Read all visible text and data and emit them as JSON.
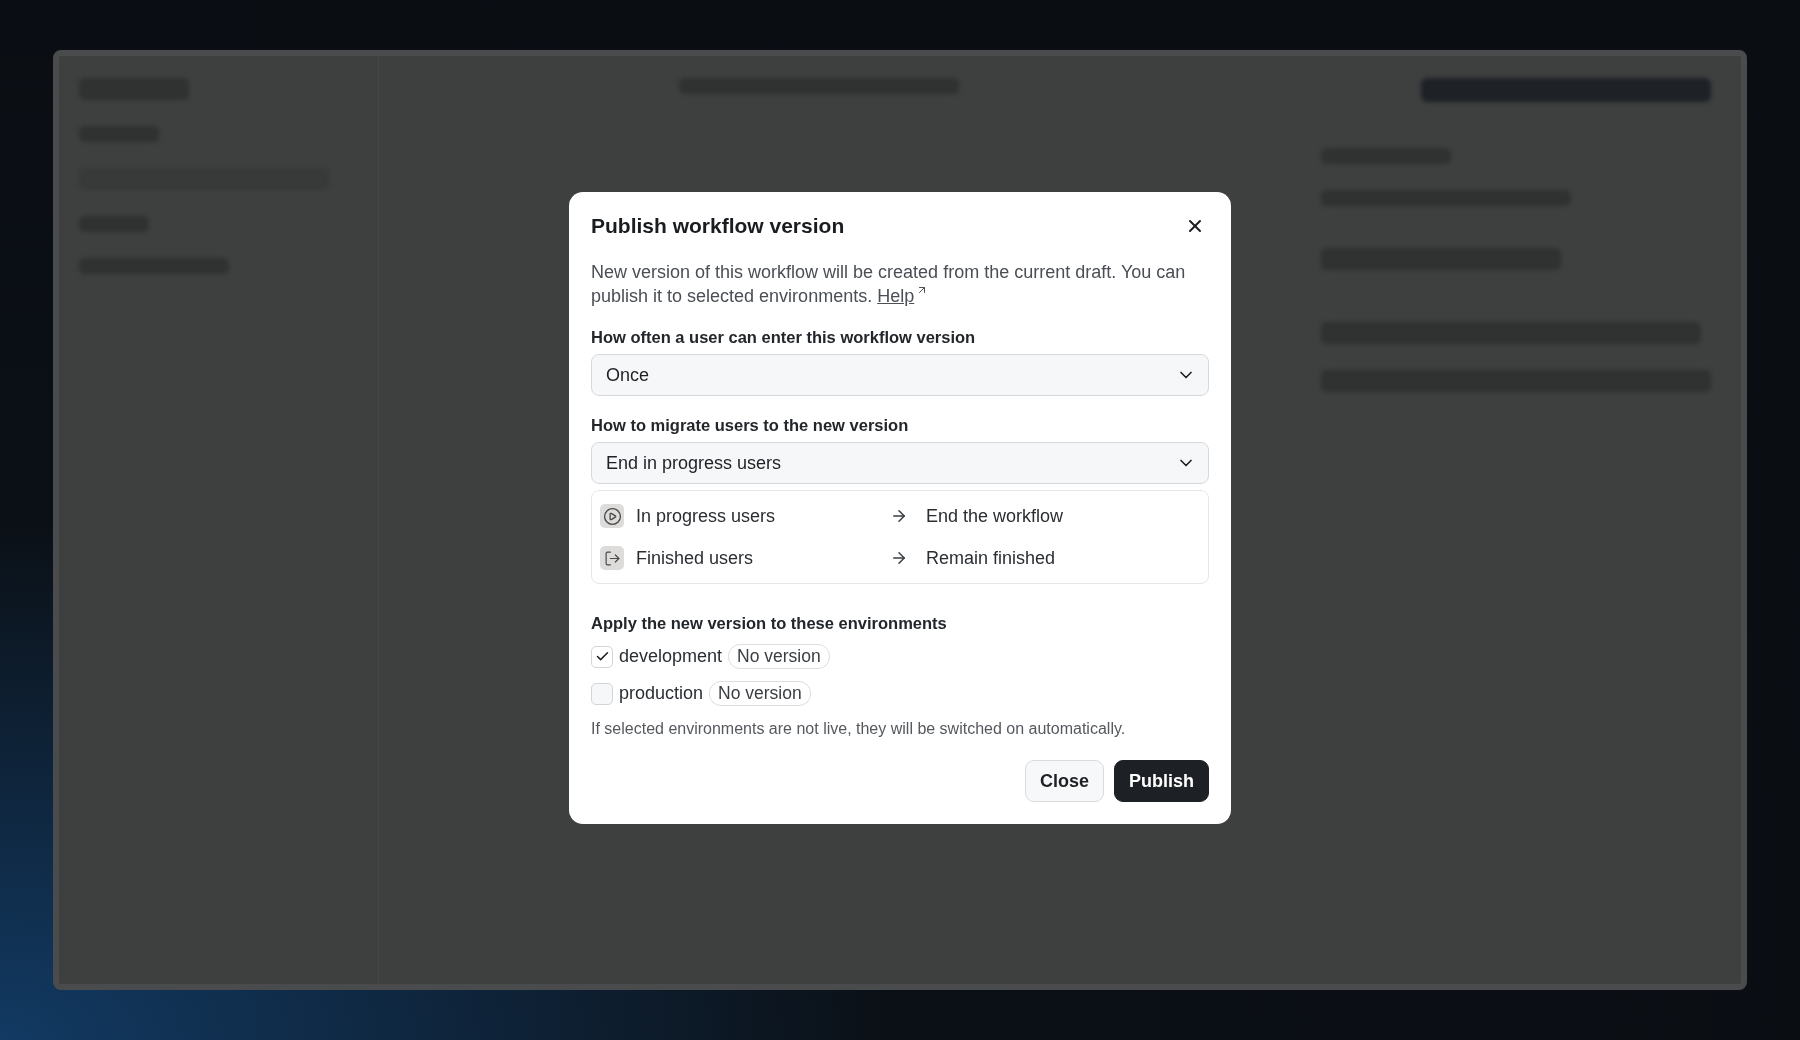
{
  "dialog": {
    "title": "Publish workflow version",
    "description": "New version of this workflow will be created from the current draft. You can publish it to selected environments.",
    "help_link": "Help",
    "frequency": {
      "label": "How often a user can enter this workflow version",
      "value": "Once"
    },
    "migration": {
      "label": "How to migrate users to the new version",
      "value": "End in progress users",
      "rules": [
        {
          "kind": "in-progress",
          "from": "In progress users",
          "to": "End the workflow"
        },
        {
          "kind": "finished",
          "from": "Finished users",
          "to": "Remain finished"
        }
      ]
    },
    "environments": {
      "label": "Apply the new version to these environments",
      "items": [
        {
          "name": "development",
          "checked": true,
          "badge": "No version"
        },
        {
          "name": "production",
          "checked": false,
          "badge": "No version"
        }
      ],
      "note": "If selected environments are not live, they will be switched on automatically."
    },
    "buttons": [
      {
        "kind": "secondary",
        "label": "Close"
      },
      {
        "kind": "primary",
        "label": "Publish"
      }
    ]
  }
}
